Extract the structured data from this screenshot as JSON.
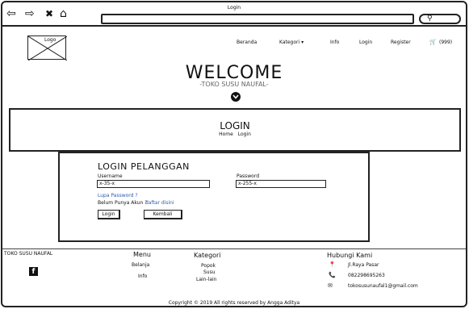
{
  "browser": {
    "title": "Login",
    "back": "⇦",
    "forward": "⇨",
    "close": "✖",
    "home": "⌂",
    "search_glyph": "⚲"
  },
  "logo": {
    "label": "Logo"
  },
  "nav": {
    "beranda": "Beranda",
    "kategori": "Kategori ▾",
    "info": "Info",
    "login": "Login",
    "register": "Register",
    "cart": "(999)"
  },
  "hero": {
    "title": "WELCOME",
    "subtitle": "-TOKO SUSU NAUFAL-"
  },
  "login_banner": {
    "title": "LOGIN",
    "home": "Home",
    "current": "Login"
  },
  "form": {
    "title": "LOGIN PELANGGAN",
    "username_label": "Username",
    "username_value": "x-35-x",
    "password_label": "Password",
    "password_value": "x-255-x",
    "forgot": "Lupa Password ?",
    "no_account": "Belum Punya Akun ?",
    "register_link": "daftar disini",
    "login_btn": "Login",
    "back_btn": "Kembali"
  },
  "footer": {
    "brand": "TOKO SUSU NAUFAL",
    "menu_title": "Menu",
    "menu": [
      "Belanja",
      "Info"
    ],
    "kategori_title": "Kategori",
    "kategori": [
      "Popok",
      "Susu",
      "Lain-lain"
    ],
    "contact_title": "Hubungi Kami",
    "address": "Jl.Raya Pasar",
    "phone": "082298695263",
    "email": "tokosusunaufal1@gmail.com",
    "copyright": "Copyright © 2019 All rights reserved by Angga Aditya"
  }
}
